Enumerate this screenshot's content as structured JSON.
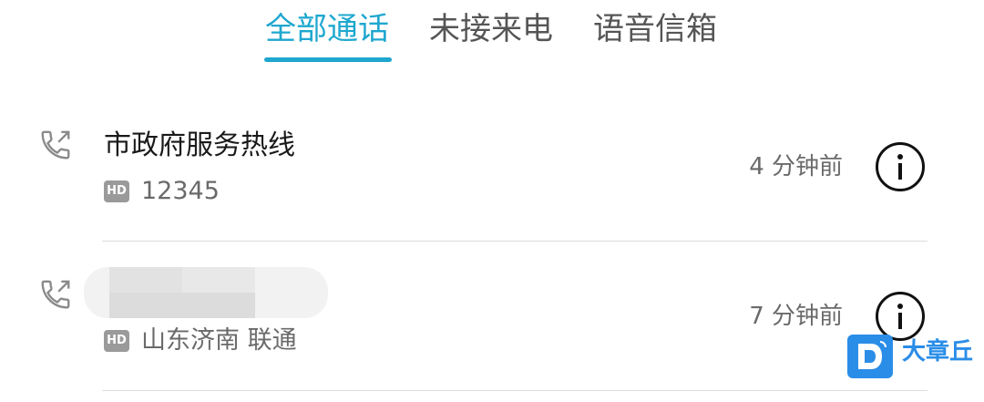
{
  "tabs": [
    {
      "label": "全部通话",
      "active": true
    },
    {
      "label": "未接来电",
      "active": false
    },
    {
      "label": "语音信箱",
      "active": false
    }
  ],
  "calls": [
    {
      "name": "市政府服务热线",
      "badge": "HD",
      "detail": "12345",
      "time": "4 分钟前",
      "icon": "outgoing-call-icon"
    },
    {
      "name": "",
      "badge": "HD",
      "detail": "山东济南 联通",
      "time": "7 分钟前",
      "icon": "outgoing-call-icon"
    }
  ],
  "watermark": {
    "text": "大章丘"
  },
  "colors": {
    "accent": "#1ea7cf",
    "watermark": "#2a8de8"
  }
}
